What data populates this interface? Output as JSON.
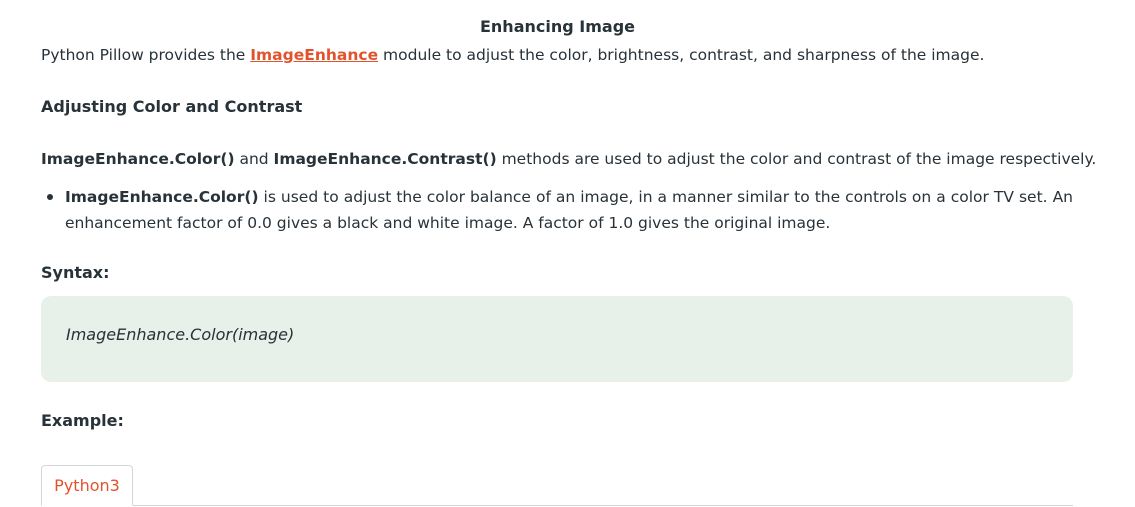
{
  "article": {
    "section_title": "Enhancing Image",
    "intro": {
      "before_link": "Python Pillow provides the ",
      "link_text": "ImageEnhance",
      "after_link": " module to adjust the color, brightness, contrast, and sharpness of the image."
    },
    "subheading": "Adjusting Color and Contrast",
    "methods_line": {
      "method1": "ImageEnhance.Color()",
      "and_text": " and ",
      "method2": "ImageEnhance.Contrast()",
      "rest": " methods are used to adjust the color and contrast of the image respectively."
    },
    "bullets": [
      {
        "method": "ImageEnhance.Color()",
        "text": " is used to adjust the color balance of an image, in a manner similar to the controls on a color TV set. An enhancement factor of 0.0 gives a black and white image. A factor of 1.0 gives the original image."
      }
    ],
    "syntax_label": "Syntax:",
    "syntax_code": "ImageEnhance.Color(image)",
    "example_label": "Example:",
    "tabs": [
      "Python3"
    ]
  },
  "colors": {
    "text": "#273239",
    "link": "#e2532d",
    "syntax_bg": "#e7f1e9",
    "tab_border": "#d6d6d6"
  }
}
